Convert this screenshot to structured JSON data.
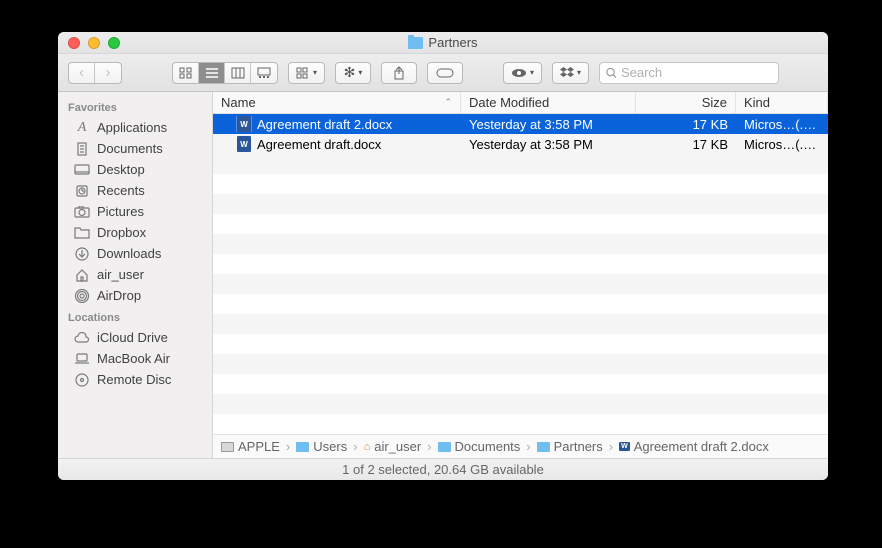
{
  "window": {
    "title": "Partners"
  },
  "toolbar": {
    "search_placeholder": "Search"
  },
  "sidebar": {
    "headers": {
      "favorites": "Favorites",
      "locations": "Locations"
    },
    "favorites": [
      {
        "id": "applications",
        "label": "Applications",
        "icon": "A"
      },
      {
        "id": "documents",
        "label": "Documents",
        "icon": "doc"
      },
      {
        "id": "desktop",
        "label": "Desktop",
        "icon": "desk"
      },
      {
        "id": "recents",
        "label": "Recents",
        "icon": "clock"
      },
      {
        "id": "pictures",
        "label": "Pictures",
        "icon": "cam"
      },
      {
        "id": "dropbox",
        "label": "Dropbox",
        "icon": "folder"
      },
      {
        "id": "downloads",
        "label": "Downloads",
        "icon": "down"
      },
      {
        "id": "airuser",
        "label": "air_user",
        "icon": "home"
      },
      {
        "id": "airdrop",
        "label": "AirDrop",
        "icon": "radio"
      }
    ],
    "locations": [
      {
        "id": "icloud",
        "label": "iCloud Drive",
        "icon": "cloud"
      },
      {
        "id": "macbook",
        "label": "MacBook Air",
        "icon": "laptop"
      },
      {
        "id": "remote",
        "label": "Remote Disc",
        "icon": "disc"
      }
    ]
  },
  "columns": {
    "name": "Name",
    "date": "Date Modified",
    "size": "Size",
    "kind": "Kind"
  },
  "files": [
    {
      "name": "Agreement draft 2.docx",
      "date": "Yesterday at 3:58 PM",
      "size": "17 KB",
      "kind": "Micros…(.docx",
      "selected": true
    },
    {
      "name": "Agreement draft.docx",
      "date": "Yesterday at 3:58 PM",
      "size": "17 KB",
      "kind": "Micros…(.docx",
      "selected": false
    }
  ],
  "path": [
    {
      "label": "APPLE",
      "icon": "hd"
    },
    {
      "label": "Users",
      "icon": "bfolder"
    },
    {
      "label": "air_user",
      "icon": "home"
    },
    {
      "label": "Documents",
      "icon": "bfolder"
    },
    {
      "label": "Partners",
      "icon": "bfolder"
    },
    {
      "label": "Agreement draft 2.docx",
      "icon": "word"
    }
  ],
  "status": "1 of 2 selected, 20.64 GB available"
}
